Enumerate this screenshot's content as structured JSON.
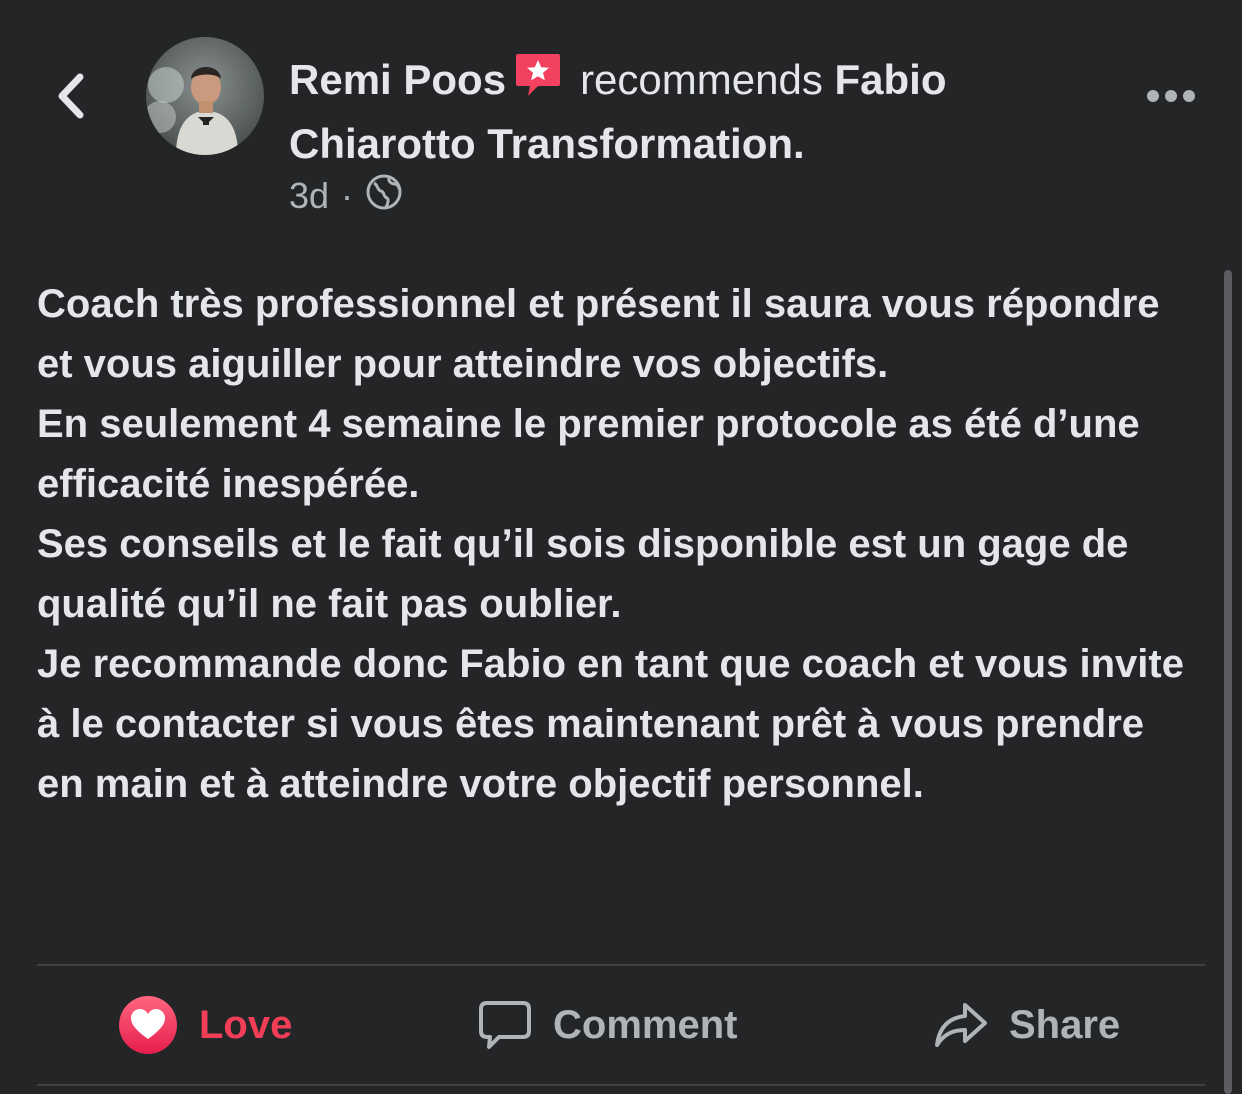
{
  "header": {
    "author_name": "Remi Poos",
    "verb": "recommends",
    "page_name": "Fabio Chiarotto Transformation",
    "suffix": ".",
    "time_ago": "3d",
    "separator": "·",
    "badge_icon": "recommendation-star-icon",
    "privacy_icon": "globe-icon"
  },
  "post": {
    "paragraphs": [
      "Coach très professionnel et présent il saura vous répondre et vous aiguiller pour atteindre vos objectifs.",
      "En seulement 4 semaine le premier protocole as été d’une efficacité inespérée.",
      "Ses conseils et le fait qu’il sois disponible est un gage de qualité qu’il ne fait pas oublier.",
      "Je recommande donc Fabio en tant que coach et vous invite à le contacter si vous êtes maintenant prêt à vous prendre en main et à atteindre votre objectif personnel."
    ]
  },
  "actions": {
    "love_label": "Love",
    "comment_label": "Comment",
    "share_label": "Share"
  },
  "colors": {
    "background": "#242526",
    "text_primary": "#e4e6eb",
    "text_secondary": "#b0b3b8",
    "love_red": "#f33e58",
    "badge_red": "#f3425f",
    "divider": "#3e4042"
  }
}
